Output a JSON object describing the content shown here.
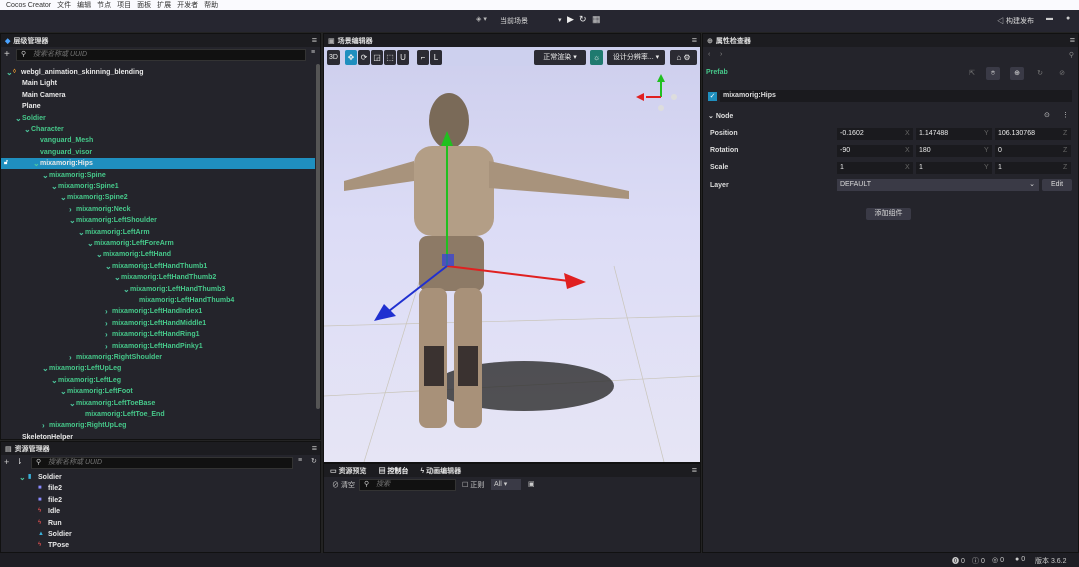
{
  "menubar": {
    "app": "Cocos Creator",
    "items": [
      "文件",
      "编辑",
      "节点",
      "项目",
      "面板",
      "扩展",
      "开发者",
      "帮助"
    ]
  },
  "toolbar": {
    "scene_select": "当前场景",
    "build_label": "构建发布"
  },
  "hierarchy": {
    "title": "层级管理器",
    "search_placeholder": "搜索名称或 UUID",
    "rows": [
      {
        "label": "webgl_animation_skinning_blending",
        "depth": 0,
        "arrow": "down",
        "color": "white"
      },
      {
        "label": "Main Light",
        "depth": 1,
        "arrow": "",
        "color": "white"
      },
      {
        "label": "Main Camera",
        "depth": 1,
        "arrow": "",
        "color": "white"
      },
      {
        "label": "Plane",
        "depth": 1,
        "arrow": "",
        "color": "white"
      },
      {
        "label": "Soldier",
        "depth": 1,
        "arrow": "down",
        "color": "green"
      },
      {
        "label": "Character",
        "depth": 2,
        "arrow": "down",
        "color": "green"
      },
      {
        "label": "vanguard_Mesh",
        "depth": 3,
        "arrow": "",
        "color": "green"
      },
      {
        "label": "vanguard_visor",
        "depth": 3,
        "arrow": "",
        "color": "green"
      },
      {
        "label": "mixamorig:Hips",
        "depth": 3,
        "arrow": "down",
        "color": "white",
        "selected": true
      },
      {
        "label": "mixamorig:Spine",
        "depth": 4,
        "arrow": "down",
        "color": "green"
      },
      {
        "label": "mixamorig:Spine1",
        "depth": 5,
        "arrow": "down",
        "color": "green"
      },
      {
        "label": "mixamorig:Spine2",
        "depth": 6,
        "arrow": "down",
        "color": "green"
      },
      {
        "label": "mixamorig:Neck",
        "depth": 7,
        "arrow": "right",
        "color": "green"
      },
      {
        "label": "mixamorig:LeftShoulder",
        "depth": 7,
        "arrow": "down",
        "color": "green"
      },
      {
        "label": "mixamorig:LeftArm",
        "depth": 8,
        "arrow": "down",
        "color": "green"
      },
      {
        "label": "mixamorig:LeftForeArm",
        "depth": 9,
        "arrow": "down",
        "color": "green"
      },
      {
        "label": "mixamorig:LeftHand",
        "depth": 10,
        "arrow": "down",
        "color": "green"
      },
      {
        "label": "mixamorig:LeftHandThumb1",
        "depth": 11,
        "arrow": "down",
        "color": "green"
      },
      {
        "label": "mixamorig:LeftHandThumb2",
        "depth": 12,
        "arrow": "down",
        "color": "green"
      },
      {
        "label": "mixamorig:LeftHandThumb3",
        "depth": 13,
        "arrow": "down",
        "color": "green"
      },
      {
        "label": "mixamorig:LeftHandThumb4",
        "depth": 14,
        "arrow": "",
        "color": "green"
      },
      {
        "label": "mixamorig:LeftHandIndex1",
        "depth": 11,
        "arrow": "right",
        "color": "green"
      },
      {
        "label": "mixamorig:LeftHandMiddle1",
        "depth": 11,
        "arrow": "right",
        "color": "green"
      },
      {
        "label": "mixamorig:LeftHandRing1",
        "depth": 11,
        "arrow": "right",
        "color": "green"
      },
      {
        "label": "mixamorig:LeftHandPinky1",
        "depth": 11,
        "arrow": "right",
        "color": "green"
      },
      {
        "label": "mixamorig:RightShoulder",
        "depth": 7,
        "arrow": "right",
        "color": "green"
      },
      {
        "label": "mixamorig:LeftUpLeg",
        "depth": 4,
        "arrow": "down",
        "color": "green"
      },
      {
        "label": "mixamorig:LeftLeg",
        "depth": 5,
        "arrow": "down",
        "color": "green"
      },
      {
        "label": "mixamorig:LeftFoot",
        "depth": 6,
        "arrow": "down",
        "color": "green"
      },
      {
        "label": "mixamorig:LeftToeBase",
        "depth": 7,
        "arrow": "down",
        "color": "green"
      },
      {
        "label": "mixamorig:LeftToe_End",
        "depth": 8,
        "arrow": "",
        "color": "green"
      },
      {
        "label": "mixamorig:RightUpLeg",
        "depth": 4,
        "arrow": "right",
        "color": "green"
      },
      {
        "label": "SkeletonHelper",
        "depth": 1,
        "arrow": "",
        "color": "white"
      }
    ]
  },
  "assets": {
    "title": "资源管理器",
    "search_placeholder": "搜索名称或 UUID",
    "items": [
      {
        "label": "Soldier",
        "icon": "prefab-folder-icon",
        "glyph": "▮",
        "color": "#3ab0d8",
        "depth": 0,
        "arrow": "down"
      },
      {
        "label": "file2",
        "icon": "texture-icon",
        "glyph": "■",
        "color": "#8a8aff",
        "depth": 1
      },
      {
        "label": "file2",
        "icon": "texture-icon",
        "glyph": "■",
        "color": "#8a8aff",
        "depth": 1
      },
      {
        "label": "Idle",
        "icon": "animation-icon",
        "glyph": "ϟ",
        "color": "#e05050",
        "depth": 1
      },
      {
        "label": "Run",
        "icon": "animation-icon",
        "glyph": "ϟ",
        "color": "#e05050",
        "depth": 1
      },
      {
        "label": "Soldier",
        "icon": "prefab-icon",
        "glyph": "▲",
        "color": "#3ab0d8",
        "depth": 1
      },
      {
        "label": "TPose",
        "icon": "animation-icon",
        "glyph": "ϟ",
        "color": "#e05050",
        "depth": 1
      }
    ]
  },
  "scene": {
    "title": "场景编辑器",
    "btn_3d": "3D",
    "render_mode": "正常渲染",
    "resolution": "设计分辨率..."
  },
  "console": {
    "tabs": [
      "资源预览",
      "控制台",
      "动画编辑器"
    ],
    "clear": "清空",
    "search_placeholder": "搜索",
    "regex": "正则",
    "level": "All"
  },
  "inspector": {
    "title": "属性检查器",
    "prefab": "Prefab",
    "node_name": "mixamorig:Hips",
    "section": "Node",
    "position": {
      "label": "Position",
      "x": "-0.1602",
      "y": "1.147488",
      "z": "106.130768"
    },
    "rotation": {
      "label": "Rotation",
      "x": "-90",
      "y": "180",
      "z": "0"
    },
    "scale": {
      "label": "Scale",
      "x": "1",
      "y": "1",
      "z": "1"
    },
    "layer": {
      "label": "Layer",
      "value": "DEFAULT",
      "edit": "Edit"
    },
    "add_component": "添加组件",
    "axis": [
      "X",
      "Y",
      "Z"
    ]
  },
  "statusbar": {
    "counts": [
      "0",
      "0",
      "0",
      "0"
    ],
    "version": "版本 3.6.2"
  }
}
